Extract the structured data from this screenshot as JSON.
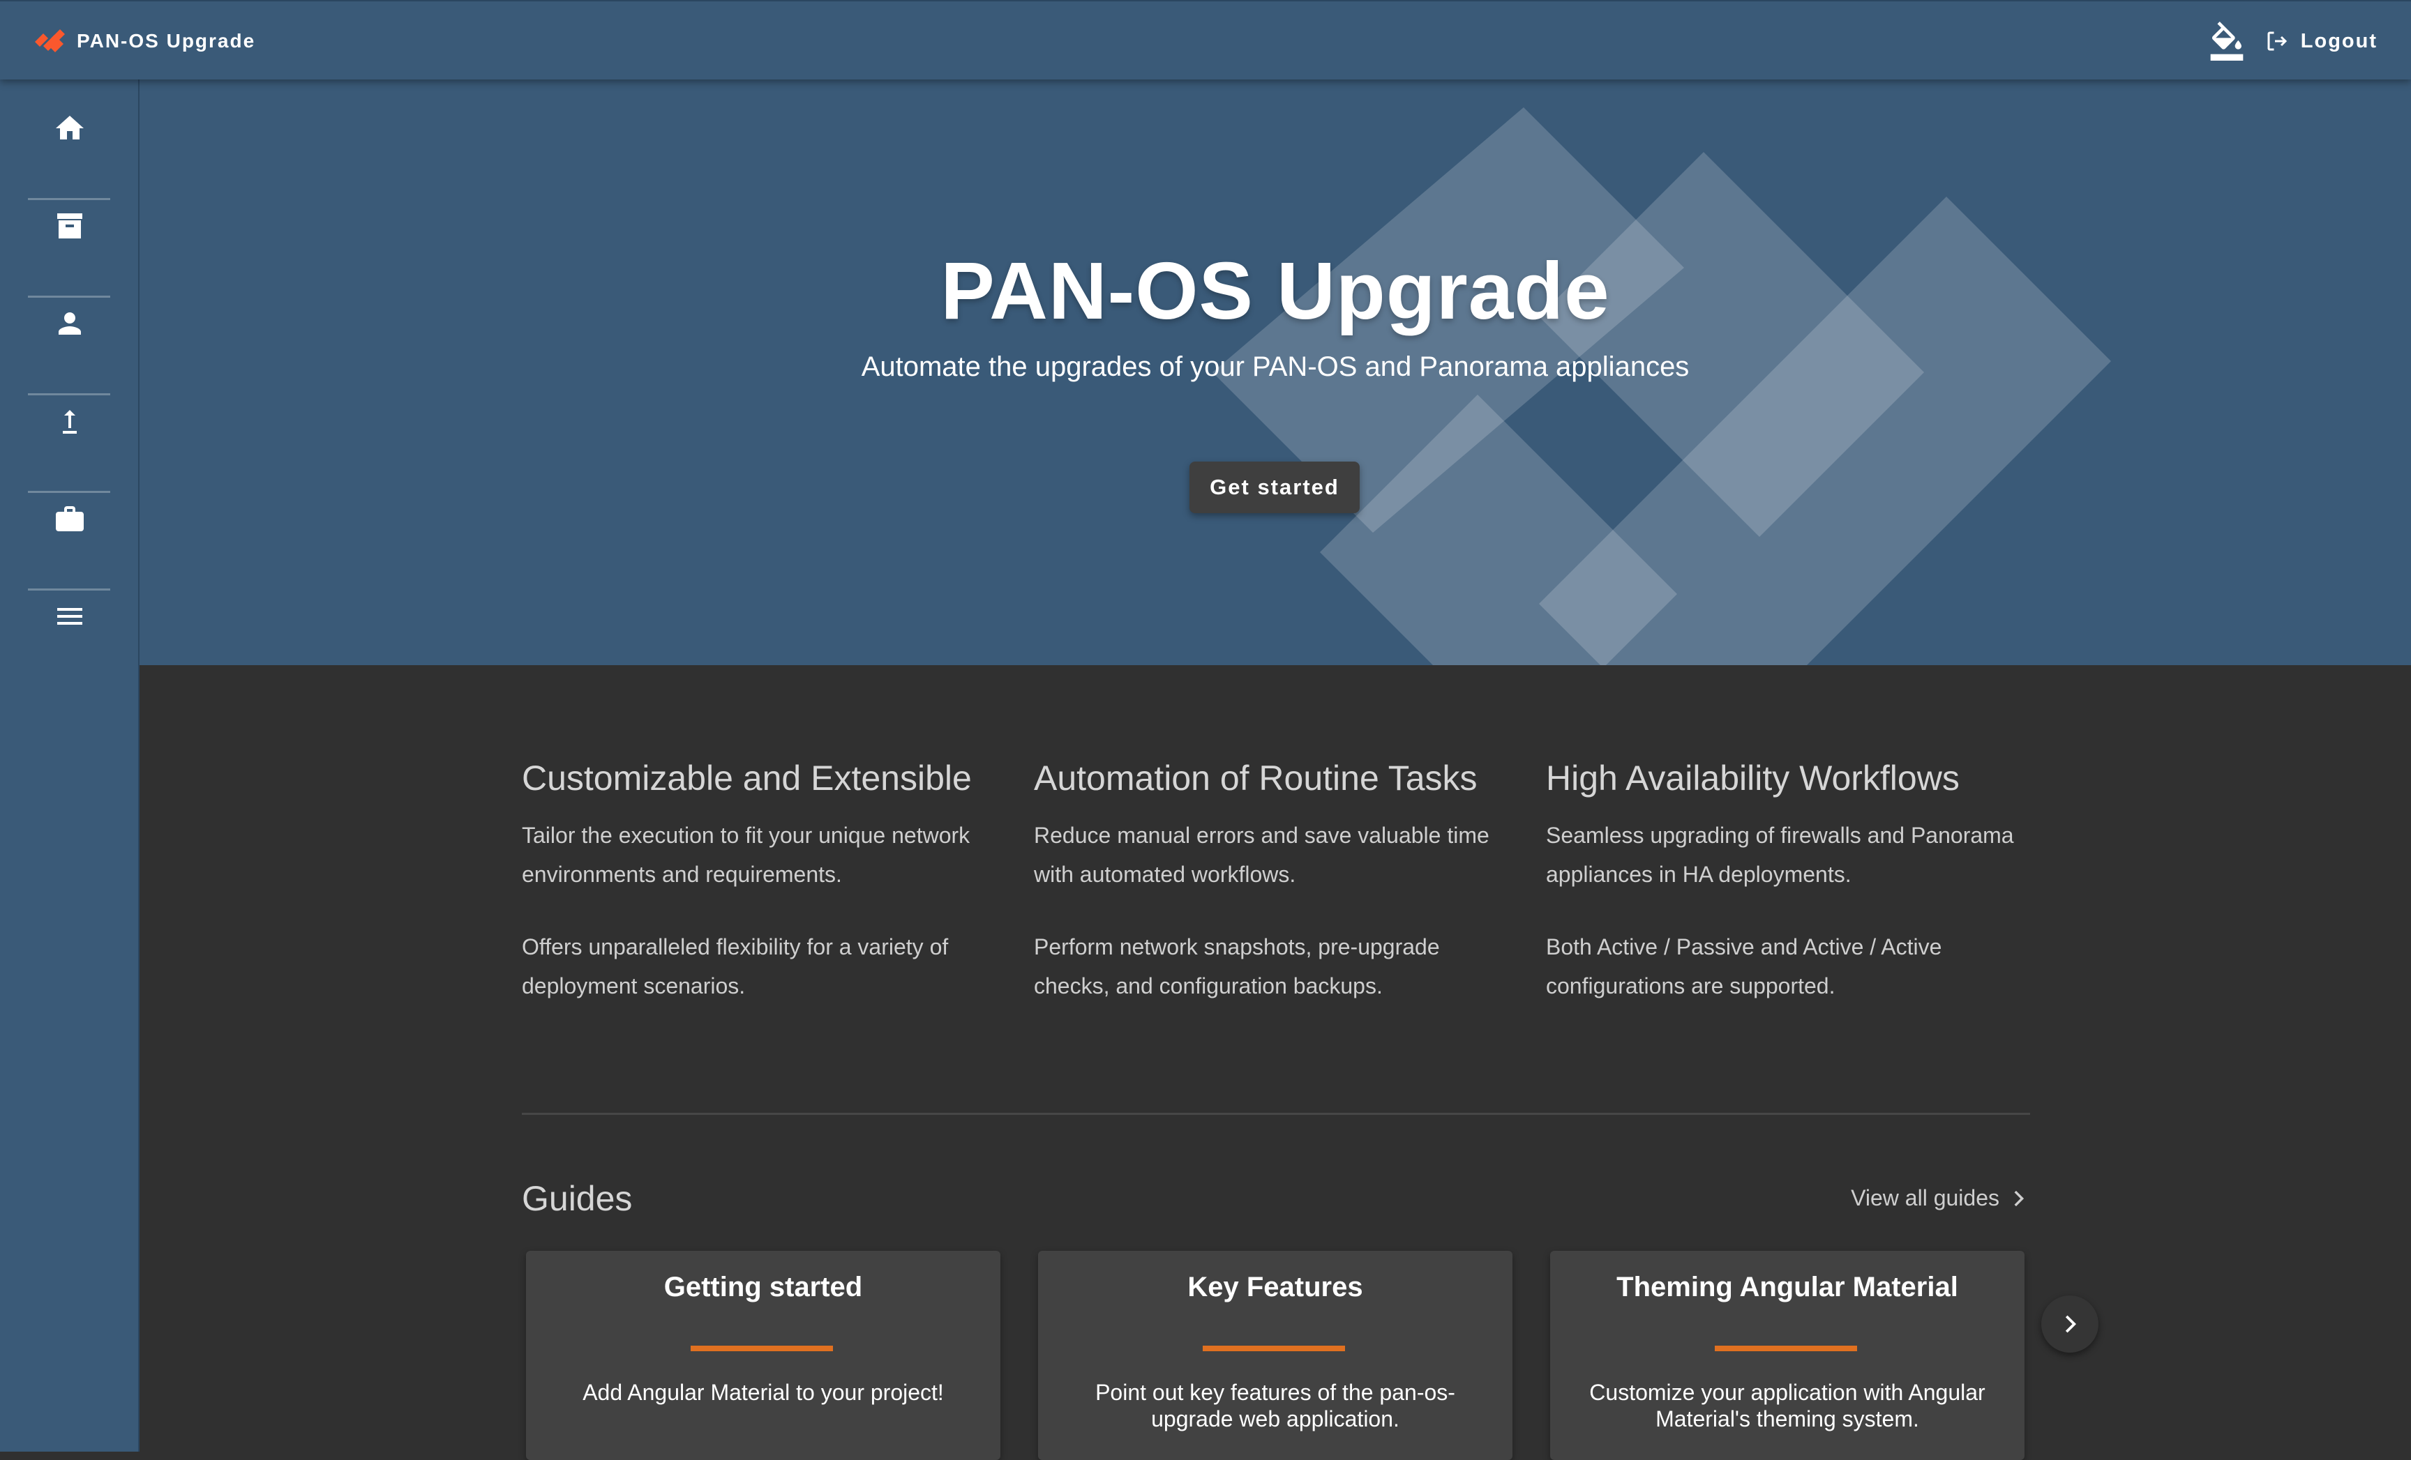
{
  "app": {
    "title": "PAN-OS Upgrade",
    "logout_label": "Logout",
    "logo_icon": "paloalto-logo-icon",
    "theme_icon": "format-color-fill-icon",
    "logout_icon": "logout-icon"
  },
  "sidebar": {
    "items": [
      {
        "name": "home",
        "icon": "home-icon"
      },
      {
        "name": "inventory",
        "icon": "archive-icon"
      },
      {
        "name": "profiles",
        "icon": "person-icon"
      },
      {
        "name": "upgrade",
        "icon": "upload-icon"
      },
      {
        "name": "jobs",
        "icon": "work-icon"
      },
      {
        "name": "menu",
        "icon": "menu-icon"
      }
    ]
  },
  "hero": {
    "title": "PAN-OS Upgrade",
    "subtitle": "Automate the upgrades of your PAN-OS and Panorama appliances",
    "cta_label": "Get started"
  },
  "features": [
    {
      "title": "Customizable and Extensible",
      "p1": "Tailor the execution to fit your unique network environments and requirements.",
      "p2": "Offers unparalleled flexibility for a variety of deployment scenarios."
    },
    {
      "title": "Automation of Routine Tasks",
      "p1": "Reduce manual errors and save valuable time with automated workflows.",
      "p2": "Perform network snapshots, pre-upgrade checks, and configuration backups."
    },
    {
      "title": "High Availability Workflows",
      "p1": "Seamless upgrading of firewalls and Panorama appliances in HA deployments.",
      "p2": "Both Active / Passive and Active / Active configurations are supported."
    }
  ],
  "guides": {
    "title": "Guides",
    "view_all_label": "View all guides",
    "cards": [
      {
        "title": "Getting started",
        "description": "Add Angular Material to your project!"
      },
      {
        "title": "Key Features",
        "description": "Point out key features of the pan-os-upgrade web application."
      },
      {
        "title": "Theming Angular Material",
        "description": "Customize your application with Angular Material's theming system."
      }
    ]
  },
  "colors": {
    "primary": "#3a5a78",
    "background": "#303030",
    "card": "#424242",
    "accent": "#e07020",
    "logo": "#fa582d"
  }
}
